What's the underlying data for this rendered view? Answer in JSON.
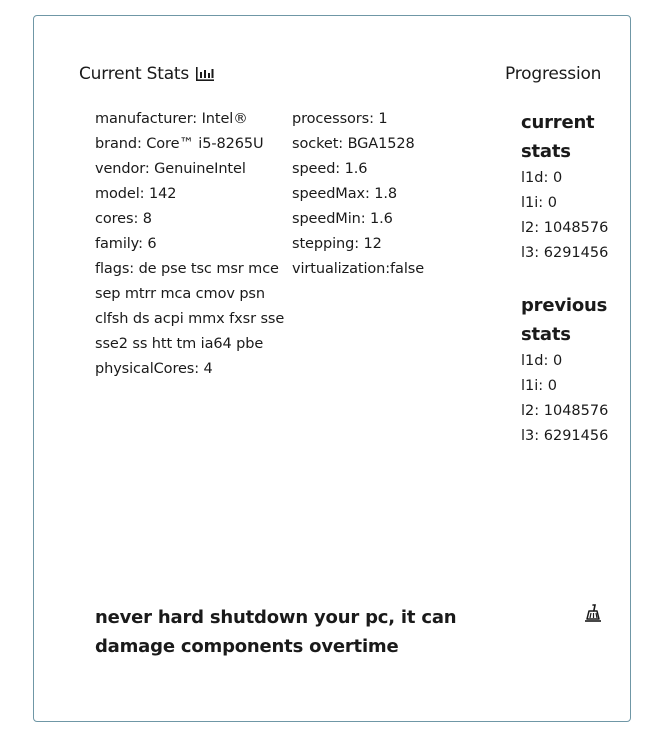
{
  "current_stats": {
    "title": "Current Stats",
    "icon": "bar-chart-icon",
    "left_column": [
      "manufacturer: Intel®",
      "brand: Core™ i5-8265U",
      "vendor: GenuineIntel",
      "model: 142",
      "cores: 8",
      "family: 6",
      "flags: de pse tsc msr mce sep mtrr mca cmov psn clfsh ds acpi mmx fxsr sse sse2 ss htt tm ia64 pbe",
      "physicalCores: 4"
    ],
    "right_column": [
      "processors: 1",
      "socket: BGA1528",
      "speed: 1.6",
      "speedMax: 1.8",
      "speedMin: 1.6",
      "stepping: 12",
      "virtualization:false"
    ]
  },
  "progression": {
    "title": "Progression",
    "current": {
      "heading": "current stats",
      "l1d": "l1d: 0",
      "l1i": "l1i: 0",
      "l2": "l2: 1048576",
      "l3": "l3: 6291456"
    },
    "previous": {
      "heading": "previous stats",
      "l1d": "l1d: 0",
      "l1i": "l1i: 0",
      "l2": "l2: 1048576",
      "l3": "l3: 6291456"
    }
  },
  "tip": {
    "text": "never hard shutdown your pc, it can damage components overtime",
    "icon": "broom-icon"
  }
}
